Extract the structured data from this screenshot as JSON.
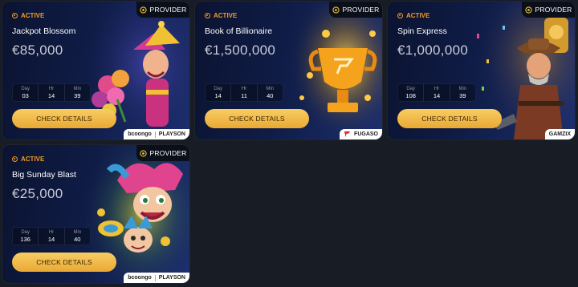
{
  "cards": [
    {
      "status": "ACTIVE",
      "provider_label": "PROVIDER",
      "title": "Jackpot Blossom",
      "amount": "€85,000",
      "timer": {
        "day_label": "Day",
        "hr_label": "Hr",
        "min_label": "Min",
        "day": "03",
        "hr": "14",
        "min": "39"
      },
      "button": "CHECK DETAILS",
      "logo": {
        "primary": "bcoongo",
        "secondary": "PLAYSON"
      }
    },
    {
      "status": "ACTIVE",
      "provider_label": "PROVIDER",
      "title": "Book of Billionaire",
      "amount": "€1,500,000",
      "timer": {
        "day_label": "Day",
        "hr_label": "Hr",
        "min_label": "Min",
        "day": "14",
        "hr": "11",
        "min": "40"
      },
      "button": "CHECK DETAILS",
      "logo": {
        "primary": "FUGASO"
      }
    },
    {
      "status": "ACTIVE",
      "provider_label": "PROVIDER",
      "title": "Spin Express",
      "amount": "€1,000,000",
      "timer": {
        "day_label": "Day",
        "hr_label": "Hr",
        "min_label": "Min",
        "day": "108",
        "hr": "14",
        "min": "39"
      },
      "button": "CHECK DETAILS",
      "logo": {
        "primary": "GAMZIX"
      }
    },
    {
      "status": "ACTIVE",
      "provider_label": "PROVIDER",
      "title": "Big Sunday Blast",
      "amount": "€25,000",
      "timer": {
        "day_label": "Day",
        "hr_label": "Hr",
        "min_label": "Min",
        "day": "136",
        "hr": "14",
        "min": "40"
      },
      "button": "CHECK DETAILS",
      "logo": {
        "primary": "bcoongo",
        "secondary": "PLAYSON"
      }
    }
  ],
  "colors": {
    "background": "#181c24",
    "accent": "#f59b1e",
    "button": "#f3bd4e"
  },
  "icons": {
    "status": "active-dot-icon",
    "provider": "provider-badge-icon"
  }
}
